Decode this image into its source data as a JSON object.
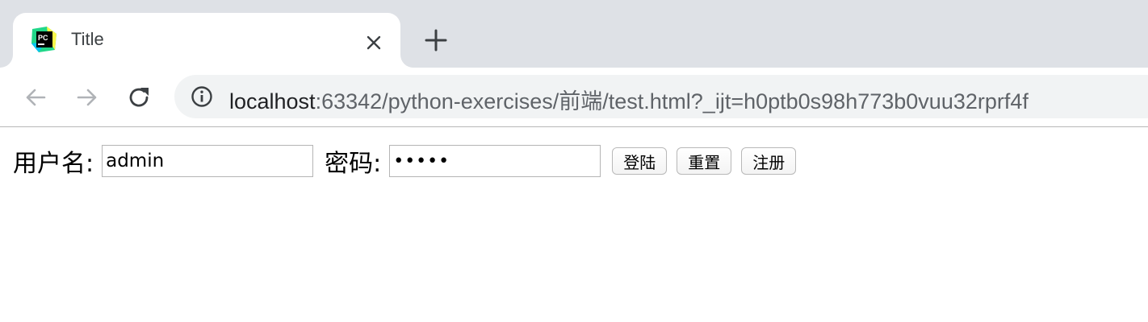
{
  "browser": {
    "tab": {
      "title": "Title",
      "favicon_text": "PC"
    },
    "address_bar": {
      "host": "localhost",
      "rest": ":63342/python-exercises/前端/test.html?_ijt=h0ptb0s98h773b0vuu32rprf4f"
    }
  },
  "form": {
    "username_label": "用户名:",
    "username_value": "admin",
    "password_label": "密码:",
    "password_mask": "•••••",
    "login_button": "登陆",
    "reset_button": "重置",
    "register_button": "注册"
  }
}
